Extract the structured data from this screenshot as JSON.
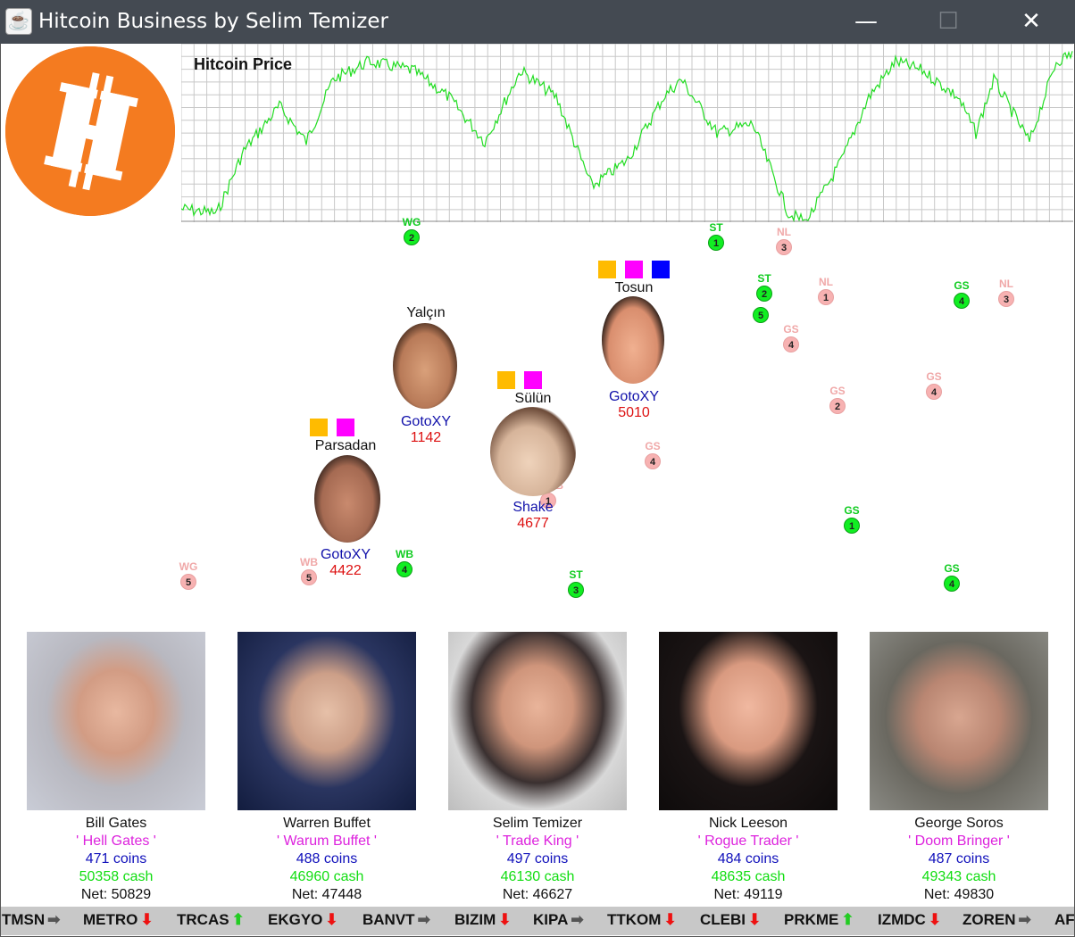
{
  "window": {
    "title": "Hitcoin Business by Selim Temizer",
    "minimize": "—",
    "maximize": "☐",
    "close": "✕"
  },
  "logo": {
    "symbol": "H",
    "color": "#f47b20"
  },
  "price_chart": {
    "title": "Hitcoin Price",
    "line_color": "#22dd22"
  },
  "markers": [
    {
      "label": "WG",
      "num": "2",
      "color": "green"
    },
    {
      "label": "ST",
      "num": "1",
      "color": "green"
    },
    {
      "label": "NL",
      "num": "3",
      "color": "pink"
    },
    {
      "label": "ST",
      "num": "2",
      "color": "green"
    },
    {
      "label": "ST",
      "num": "5",
      "color": "green"
    },
    {
      "label": "NL",
      "num": "1",
      "color": "pink"
    },
    {
      "label": "GS",
      "num": "4",
      "color": "green"
    },
    {
      "label": "NL",
      "num": "3",
      "color": "pink"
    },
    {
      "label": "GS",
      "num": "4",
      "color": "pink"
    },
    {
      "label": "GS",
      "num": "2",
      "color": "pink"
    },
    {
      "label": "GS",
      "num": "4",
      "color": "pink"
    },
    {
      "label": "GS",
      "num": "4",
      "color": "pink"
    },
    {
      "label": "WB",
      "num": "1",
      "color": "pink"
    },
    {
      "label": "GS",
      "num": "1",
      "color": "green"
    },
    {
      "label": "WG",
      "num": "5",
      "color": "pink"
    },
    {
      "label": "WB",
      "num": "5",
      "color": "pink"
    },
    {
      "label": "WB",
      "num": "4",
      "color": "green"
    },
    {
      "label": "ST",
      "num": "3",
      "color": "green"
    },
    {
      "label": "GS",
      "num": "4",
      "color": "green"
    }
  ],
  "agents": [
    {
      "name": "Yalçın",
      "action": "GotoXY",
      "money": "1142"
    },
    {
      "name": "Parsadan",
      "action": "GotoXY",
      "money": "4422",
      "items": [
        "#ffbb00",
        "#ff00ff"
      ]
    },
    {
      "name": "Sülün",
      "action": "Shake",
      "money": "4677",
      "items": [
        "#ffbb00",
        "#ff00ff"
      ]
    },
    {
      "name": "Tosun",
      "action": "GotoXY",
      "money": "5010",
      "items": [
        "#ffbb00",
        "#ff00ff",
        "#0000ff"
      ]
    }
  ],
  "players": [
    {
      "name": "Bill Gates",
      "nick": "' Hell Gates '",
      "coins": "471 coins",
      "cash": "50358 cash",
      "net": "Net: 50829"
    },
    {
      "name": "Warren Buffet",
      "nick": "' Warum Buffet '",
      "coins": "488 coins",
      "cash": "46960 cash",
      "net": "Net: 47448"
    },
    {
      "name": "Selim Temizer",
      "nick": "' Trade King '",
      "coins": "497 coins",
      "cash": "46130 cash",
      "net": "Net: 46627"
    },
    {
      "name": "Nick Leeson",
      "nick": "' Rogue Trader '",
      "coins": "484 coins",
      "cash": "48635 cash",
      "net": "Net: 49119"
    },
    {
      "name": "George Soros",
      "nick": "' Doom Bringer '",
      "coins": "487 coins",
      "cash": "49343 cash",
      "net": "Net: 49830"
    }
  ],
  "ticker": [
    {
      "symbol": "TMSN",
      "trend": "flat"
    },
    {
      "symbol": "METRO",
      "trend": "down"
    },
    {
      "symbol": "TRCAS",
      "trend": "up"
    },
    {
      "symbol": "EKGYO",
      "trend": "down"
    },
    {
      "symbol": "BANVT",
      "trend": "flat"
    },
    {
      "symbol": "BIZIM",
      "trend": "down"
    },
    {
      "symbol": "KIPA",
      "trend": "flat"
    },
    {
      "symbol": "TTKOM",
      "trend": "down"
    },
    {
      "symbol": "CLEBI",
      "trend": "down"
    },
    {
      "symbol": "PRKME",
      "trend": "up"
    },
    {
      "symbol": "IZMDC",
      "trend": "down"
    },
    {
      "symbol": "ZOREN",
      "trend": "flat"
    },
    {
      "symbol": "AF",
      "trend": "none"
    }
  ]
}
